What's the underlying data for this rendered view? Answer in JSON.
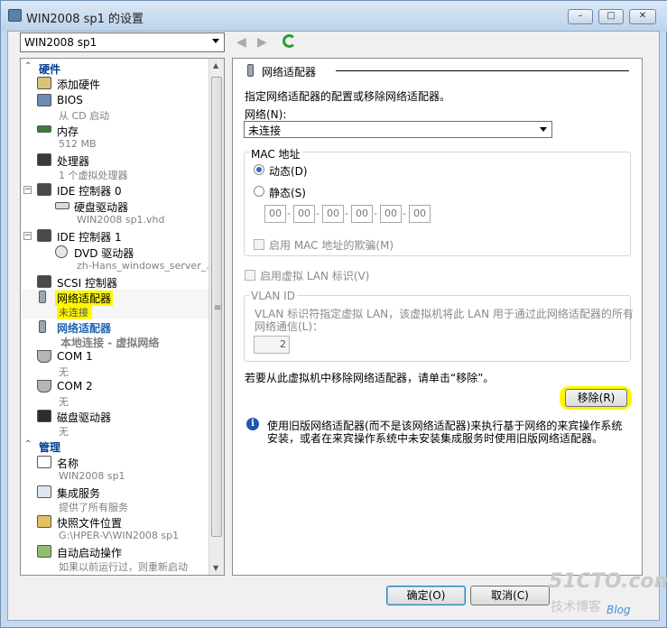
{
  "window": {
    "title": "WIN2008 sp1 的设置",
    "minimize_glyph": "–",
    "maximize_glyph": "□",
    "close_glyph": "✕"
  },
  "vm_select": {
    "value": "WIN2008 sp1"
  },
  "nav": {
    "back_glyph": "◀",
    "forward_glyph": "▶",
    "resize_glyph": "≡",
    "scroll_up_glyph": "▲",
    "scroll_down_glyph": "▼"
  },
  "tree": {
    "hardware_header": "硬件",
    "management_header": "管理",
    "section_chevron": "⌃",
    "items": [
      {
        "main": "添加硬件",
        "sub": ""
      },
      {
        "main": "BIOS",
        "sub": "从 CD 启动"
      },
      {
        "main": "内存",
        "sub": "512 MB"
      },
      {
        "main": "处理器",
        "sub": "1 个虚拟处理器"
      },
      {
        "main": "IDE 控制器 0",
        "sub": ""
      },
      {
        "main": "硬盘驱动器",
        "sub": "WIN2008 sp1.vhd"
      },
      {
        "main": "IDE 控制器 1",
        "sub": ""
      },
      {
        "main": "DVD 驱动器",
        "sub": "zh-Hans_windows_server_..."
      },
      {
        "main": "SCSI 控制器",
        "sub": ""
      },
      {
        "main": "网络适配器",
        "sub": "未连接"
      },
      {
        "main": "网络适配器",
        "sub": "本地连接 - 虚拟网络"
      },
      {
        "main": "COM 1",
        "sub": "无"
      },
      {
        "main": "COM 2",
        "sub": "无"
      },
      {
        "main": "磁盘驱动器",
        "sub": "无"
      },
      {
        "main": "名称",
        "sub": "WIN2008 sp1"
      },
      {
        "main": "集成服务",
        "sub": "提供了所有服务"
      },
      {
        "main": "快照文件位置",
        "sub": "G:\\HPER-V\\WIN2008 sp1"
      },
      {
        "main": "自动启动操作",
        "sub": "如果以前运行过，则重新启动"
      }
    ],
    "expander_minus": "−"
  },
  "panel": {
    "heading": "网络适配器",
    "description": "指定网络适配器的配置或移除网络适配器。",
    "network_label": "网络(N):",
    "network_value": "未连接",
    "mac_group_label": "MAC 地址",
    "mac_dynamic": "动态(D)",
    "mac_static": "静态(S)",
    "mac_octets": [
      "00",
      "00",
      "00",
      "00",
      "00",
      "00"
    ],
    "mac_dash": "-",
    "mac_spoofing": "启用 MAC 地址的欺骗(M)",
    "vlan_enable": "启用虚拟 LAN 标识(V)",
    "vlan_group_label": "VLAN ID",
    "vlan_desc_line1": "VLAN 标识符指定虚拟 LAN，该虚拟机将此 LAN 用于通过此网络适配器的所有",
    "vlan_desc_line2": "网络通信(L)：",
    "vlan_value": "2",
    "remove_hint": "若要从此虚拟机中移除网络适配器，请单击“移除”。",
    "remove_button": "移除(R)",
    "info_glyph": "i",
    "info_line1": "使用旧版网络适配器(而不是该网络适配器)来执行基于网络的来宾操作系统",
    "info_line2": "安装，或者在来宾操作系统中未安装集成服务时使用旧版网络适配器。"
  },
  "footer": {
    "ok_button": "确定(O)",
    "cancel_button": "取消(C)"
  },
  "watermark": {
    "line1": "51CTO.com",
    "line2": "技术博客",
    "line3": "Blog"
  },
  "colors": {
    "highlight": "#fff700",
    "section_header": "#003e92",
    "link_blue": "#1f64b5"
  }
}
